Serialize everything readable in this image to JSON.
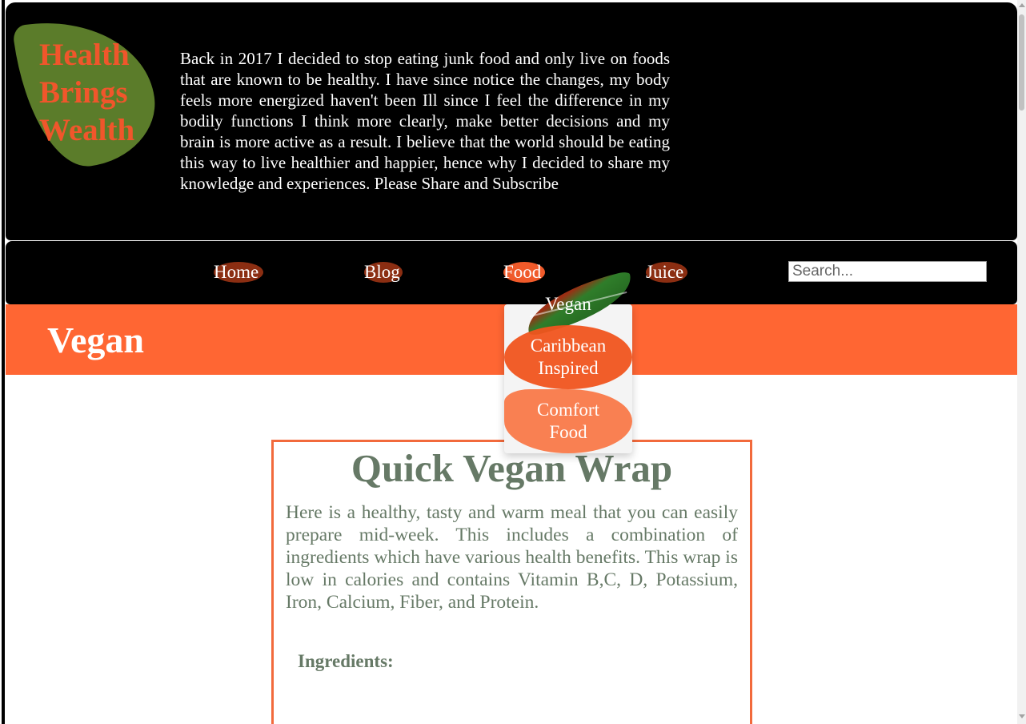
{
  "logo": {
    "lines": [
      "Health",
      "Brings",
      "Wealth"
    ],
    "text_color": "#f0562b",
    "leaf_color": "#5b7c2a"
  },
  "header": {
    "intro": "Back in 2017 I decided to stop eating junk food and only live on foods that are known to be healthy. I have since notice the changes, my body feels more energized haven't been Ill since I feel the difference in my bodily functions I think more clearly, make better decisions and my brain is more active as a result. I believe that the world should be eating this way to live healthier and happier, hence why I decided to share my knowledge and experiences. Please Share and Subscribe"
  },
  "nav": {
    "items": [
      {
        "label": "Home"
      },
      {
        "label": "Blog"
      },
      {
        "label": "Food"
      },
      {
        "label": "Juice"
      }
    ],
    "search_placeholder": "Search...",
    "search_value": ""
  },
  "dropdown": {
    "items": [
      {
        "label": "Vegan"
      },
      {
        "label": "Caribbean Inspired"
      },
      {
        "label": "Comfort Food"
      }
    ]
  },
  "banner": {
    "title": "Vegan",
    "color": "#ff6633"
  },
  "recipe": {
    "title": "Quick Vegan Wrap",
    "description": "Here is a healthy, tasty and warm meal that you can easily prepare mid-week. This includes a combination of ingredients which have various health benefits. This wrap is low in calories and contains Vitamin B,C, D, Potassium, Iron, Calcium, Fiber, and Protein.",
    "ingredients_heading": "Ingredients:",
    "border_color": "#f26a3c",
    "text_color": "#667966"
  }
}
